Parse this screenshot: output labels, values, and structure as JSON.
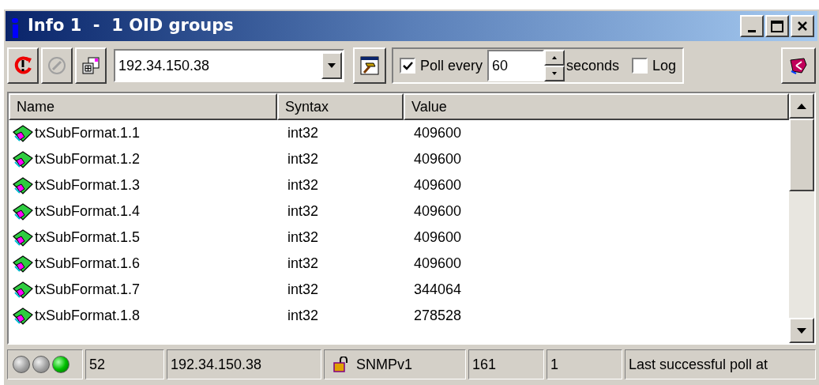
{
  "window": {
    "title": "Info 1  -  1 OID groups"
  },
  "toolbar": {
    "address": "192.34.150.38",
    "poll": {
      "checked": true,
      "label": "Poll every",
      "interval": "60",
      "unit": "seconds"
    },
    "log": {
      "checked": false,
      "label": "Log"
    }
  },
  "table": {
    "columns": [
      "Name",
      "Syntax",
      "Value"
    ],
    "rows": [
      {
        "name": "txSubFormat.1.1",
        "syntax": "int32",
        "value": "409600"
      },
      {
        "name": "txSubFormat.1.2",
        "syntax": "int32",
        "value": "409600"
      },
      {
        "name": "txSubFormat.1.3",
        "syntax": "int32",
        "value": "409600"
      },
      {
        "name": "txSubFormat.1.4",
        "syntax": "int32",
        "value": "409600"
      },
      {
        "name": "txSubFormat.1.5",
        "syntax": "int32",
        "value": "409600"
      },
      {
        "name": "txSubFormat.1.6",
        "syntax": "int32",
        "value": "409600"
      },
      {
        "name": "txSubFormat.1.7",
        "syntax": "int32",
        "value": "344064"
      },
      {
        "name": "txSubFormat.1.8",
        "syntax": "int32",
        "value": "278528"
      }
    ]
  },
  "status_bar": {
    "lights": [
      {
        "on": false
      },
      {
        "on": false
      },
      {
        "on": true
      }
    ],
    "count": "52",
    "address": "192.34.150.38",
    "protocol": "SNMPv1",
    "port": "161",
    "field_6": "1",
    "message": "Last successful poll at"
  }
}
